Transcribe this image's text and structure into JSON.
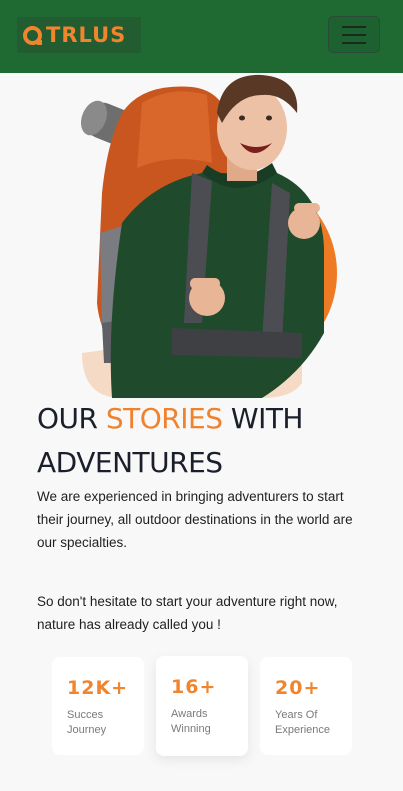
{
  "header": {
    "logo_text": "TRLUS",
    "menu_icon": "hamburger-icon"
  },
  "hero": {
    "image": "backpacker-pointing-photo",
    "accent_color": "#f0822d"
  },
  "headline": {
    "part1": "OUR ",
    "accent": "STORIES",
    "part2": " WITH ADVENTURES"
  },
  "paragraphs": [
    "We are experienced in bringing adventurers to start their journey, all outdoor destinations in the world are our specialties.",
    "So don't hesitate to start your adventure right now, nature has already called you !"
  ],
  "stats": [
    {
      "value": "12K+",
      "label_line1": "Succes",
      "label_line2": "Journey"
    },
    {
      "value": "16+",
      "label_line1": "Awards",
      "label_line2": "Winning"
    },
    {
      "value": "20+",
      "label_line1": "Years Of",
      "label_line2": "Experience"
    }
  ],
  "colors": {
    "nav_bg": "#1f6a32",
    "accent": "#f0852d",
    "heading": "#1a1f2b"
  }
}
